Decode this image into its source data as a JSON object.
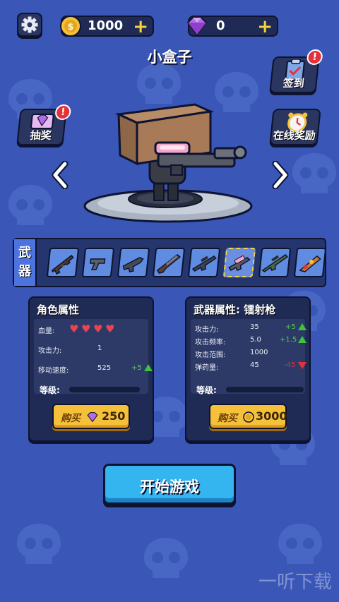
{
  "header": {
    "coins": "1000",
    "gems": "0"
  },
  "character": {
    "name": "小盒子"
  },
  "side_buttons": {
    "signin": "签到",
    "lottery": "抽奖",
    "online_reward": "在线奖励",
    "alert_mark": "!"
  },
  "weapons": {
    "tag_line1": "武",
    "tag_line2": "器",
    "slots": [
      "assault-rifle",
      "pistol",
      "smg",
      "shotgun",
      "sniper-dark",
      "laser-gun",
      "sniper-green",
      "rocket-launcher"
    ],
    "selected_index": 5
  },
  "character_panel": {
    "title": "角色属性",
    "hp_label": "血量:",
    "hp_hearts": 4,
    "attack_label": "攻击力:",
    "attack_value": "1",
    "speed_label": "移动速度:",
    "speed_value": "525",
    "speed_delta": "+5",
    "level_label": "等级:",
    "buy_label": "购买",
    "price": "250"
  },
  "weapon_panel": {
    "title": "武器属性: 镭射枪",
    "attack_label": "攻击力:",
    "attack_value": "35",
    "attack_delta": "+5",
    "rate_label": "攻击频率:",
    "rate_value": "5.0",
    "rate_delta": "+1.5",
    "range_label": "攻击范围:",
    "range_value": "1000",
    "ammo_label": "弹药量:",
    "ammo_value": "45",
    "ammo_delta": "-45",
    "level_label": "等级:",
    "buy_label": "购买",
    "price": "3000"
  },
  "start_button": "开始游戏",
  "watermark": "一听下载",
  "colors": {
    "background": "#3a57b8",
    "panel": "#1f2b55",
    "accent_gold": "#f5c13a",
    "start_blue": "#35b5ef",
    "gem_purple": "#b46be6",
    "alert_red": "#e3323a"
  }
}
